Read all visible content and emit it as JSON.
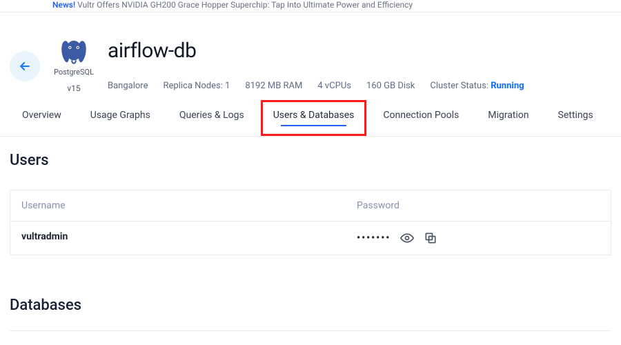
{
  "topbar": {
    "news_label": "News!",
    "news_text": "Vultr Offers NVIDIA GH200 Grace Hopper Superchip: Tap Into Ultimate Power and Efficiency"
  },
  "header": {
    "db_type": "PostgreSQL",
    "db_version": "v15",
    "title": "airflow-db",
    "meta": {
      "region": "Bangalore",
      "replica": "Replica Nodes: 1",
      "ram": "8192 MB RAM",
      "vcpu": "4 vCPUs",
      "disk": "160 GB Disk",
      "status_label": "Cluster Status:",
      "status_value": "Running"
    }
  },
  "tabs": [
    {
      "key": "overview",
      "label": "Overview"
    },
    {
      "key": "usage",
      "label": "Usage Graphs"
    },
    {
      "key": "queries",
      "label": "Queries & Logs"
    },
    {
      "key": "users",
      "label": "Users & Databases"
    },
    {
      "key": "pools",
      "label": "Connection Pools"
    },
    {
      "key": "migration",
      "label": "Migration"
    },
    {
      "key": "settings",
      "label": "Settings"
    }
  ],
  "active_tab": "users",
  "highlighted_tab": "users",
  "sections": {
    "users_title": "Users",
    "databases_title": "Databases",
    "users_table": {
      "col_username": "Username",
      "col_password": "Password",
      "rows": [
        {
          "username": "vultradmin",
          "password_masked": "•••••••"
        }
      ]
    }
  },
  "colors": {
    "accent_blue": "#2563eb",
    "highlight_red": "#ff1a1a",
    "back_btn_bg": "#eaf4ff"
  }
}
